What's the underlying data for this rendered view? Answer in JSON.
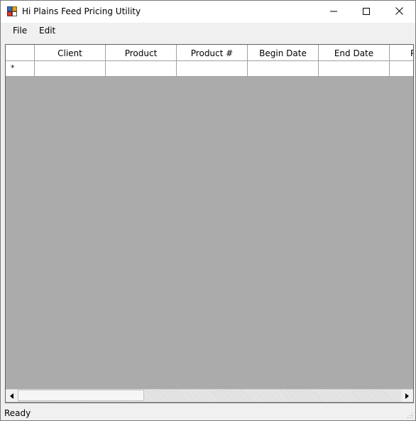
{
  "window": {
    "title": "Hi Plains Feed Pricing Utility",
    "icon": "app-grid-icon"
  },
  "title_controls": {
    "minimize_icon": "minimize-icon",
    "maximize_icon": "maximize-icon",
    "close_icon": "close-icon"
  },
  "menu": {
    "items": [
      {
        "label": "File"
      },
      {
        "label": "Edit"
      }
    ]
  },
  "grid": {
    "columns": [
      "Client",
      "Product",
      "Product #",
      "Begin Date",
      "End Date",
      "P"
    ],
    "new_row_marker": "*",
    "rows": []
  },
  "status": {
    "text": "Ready"
  },
  "colors": {
    "grid_background": "#ababab",
    "window_background": "#f0f0f0",
    "titlebar_background": "#ffffff"
  }
}
